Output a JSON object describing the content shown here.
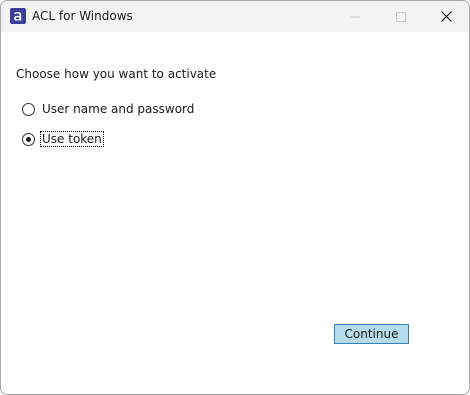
{
  "window": {
    "title": "ACL for Windows",
    "app_icon": "acl-logo-icon",
    "controls": [
      "minimize-icon",
      "maximize-icon",
      "close-icon"
    ]
  },
  "activation": {
    "prompt": "Choose how you want to activate",
    "options": [
      {
        "label": "User name and password",
        "selected": false
      },
      {
        "label": "Use token",
        "selected": true
      }
    ]
  },
  "actions": {
    "continue_label": "Continue"
  },
  "colors": {
    "titlebar_bg": "#f3f3f3",
    "button_bg": "#b4dced",
    "button_border": "#3c7fb1",
    "app_icon_blue": "#3a3f9a"
  }
}
